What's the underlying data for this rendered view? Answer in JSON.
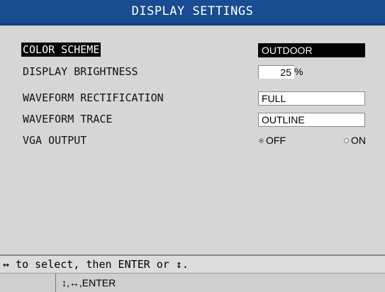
{
  "header": {
    "title": "DISPLAY SETTINGS"
  },
  "settings": {
    "color_scheme": {
      "label": "COLOR SCHEME",
      "value": "OUTDOOR"
    },
    "display_brightness": {
      "label": "DISPLAY BRIGHTNESS",
      "value": "25",
      "unit": "%"
    },
    "waveform_rectification": {
      "label": "WAVEFORM RECTIFICATION",
      "value": "FULL"
    },
    "waveform_trace": {
      "label": "WAVEFORM TRACE",
      "value": "OUTLINE"
    },
    "vga_output": {
      "label": "VGA OUTPUT",
      "options": [
        {
          "label": "OFF",
          "selected": true
        },
        {
          "label": "ON",
          "selected": false
        }
      ]
    }
  },
  "footer": {
    "help": "↔ to select, then ENTER or ↕.",
    "keys": "↕,↔,ENTER"
  }
}
